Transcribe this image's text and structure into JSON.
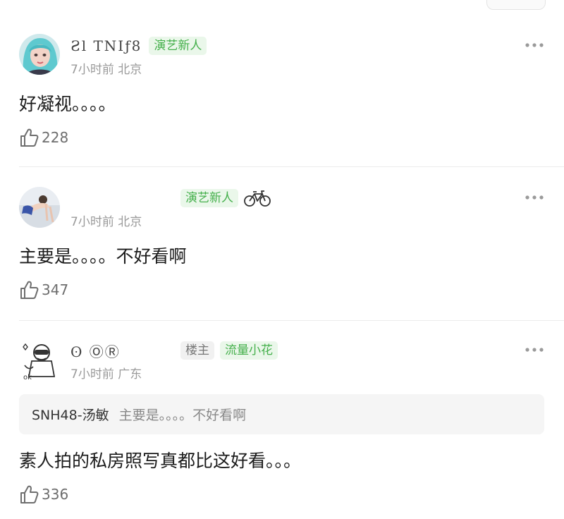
{
  "comments": [
    {
      "username": "Ƨl TNIƒ8",
      "badges": [
        "演艺新人"
      ],
      "time": "7小时前",
      "location": "北京",
      "text": "好凝视。。。。",
      "likes": "228",
      "avatar_icon": "avatar-teal-hair-icon"
    },
    {
      "username": "",
      "badges": [
        "演艺新人"
      ],
      "time": "7小时前",
      "location": "北京",
      "text": "主要是。。。。不好看啊",
      "likes": "347",
      "avatar_icon": "avatar-beach-icon",
      "extra_icon": "bicycle-icon"
    },
    {
      "username": "ʘ ⓄⓇ",
      "badges": [
        "楼主",
        "流量小花"
      ],
      "time": "7小时前",
      "location": "广东",
      "text": "素人拍的私房照写真都比这好看。。。",
      "likes": "336",
      "avatar_icon": "avatar-sketch-icon",
      "quote": {
        "author": "SNH48-汤敏",
        "text": "主要是。。。。不好看啊"
      }
    }
  ],
  "colors": {
    "badge_green_bg": "#eaf7ea",
    "badge_green_text": "#45b04c",
    "badge_gray_bg": "#f1f1f1",
    "meta_text": "#9a9a9a"
  }
}
